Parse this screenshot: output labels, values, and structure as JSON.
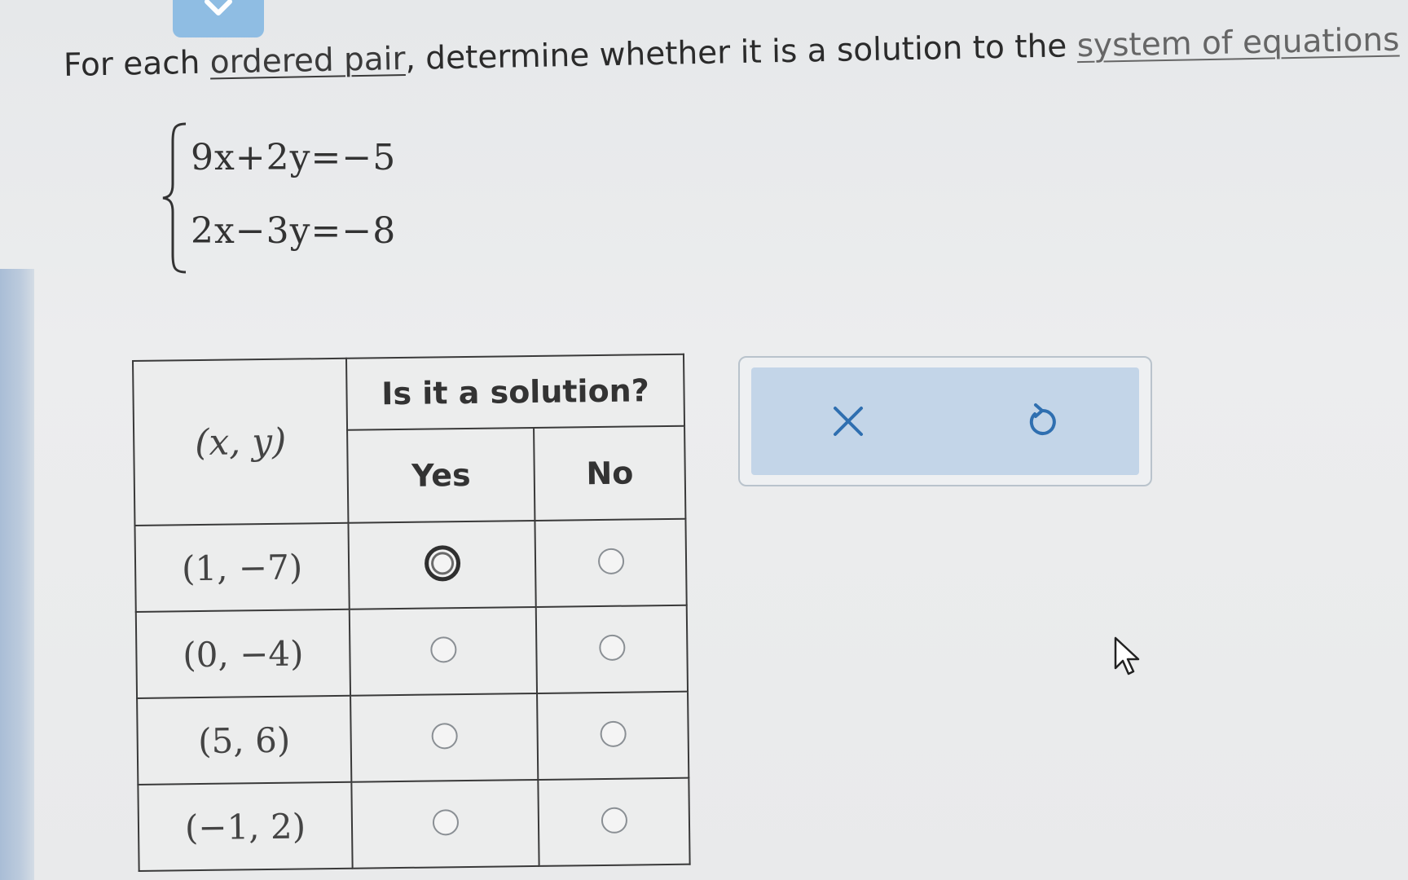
{
  "question": {
    "prefix": "For each ",
    "link_ordered_pair": "ordered pair",
    "middle": ", determine whether it is a solution to the ",
    "link_system": "system of equations"
  },
  "system": {
    "equations": [
      "9x+2y=−5",
      "2x−3y=−8"
    ]
  },
  "table": {
    "header_pair": "(x, y)",
    "header_question": "Is it a solution?",
    "col_yes": "Yes",
    "col_no": "No",
    "rows": [
      {
        "pair": "(1, −7)"
      },
      {
        "pair": "(0, −4)"
      },
      {
        "pair": "(5, 6)"
      },
      {
        "pair": "(−1, 2)"
      }
    ]
  },
  "icons": {
    "top_tab": "chevron-down-icon",
    "clear": "close-icon",
    "undo": "undo-icon",
    "cursor": "pointer-cursor-icon"
  },
  "colors": {
    "tab": "#8fbde3",
    "action_panel": "#c3d5e8",
    "icon": "#2f6fb0"
  }
}
